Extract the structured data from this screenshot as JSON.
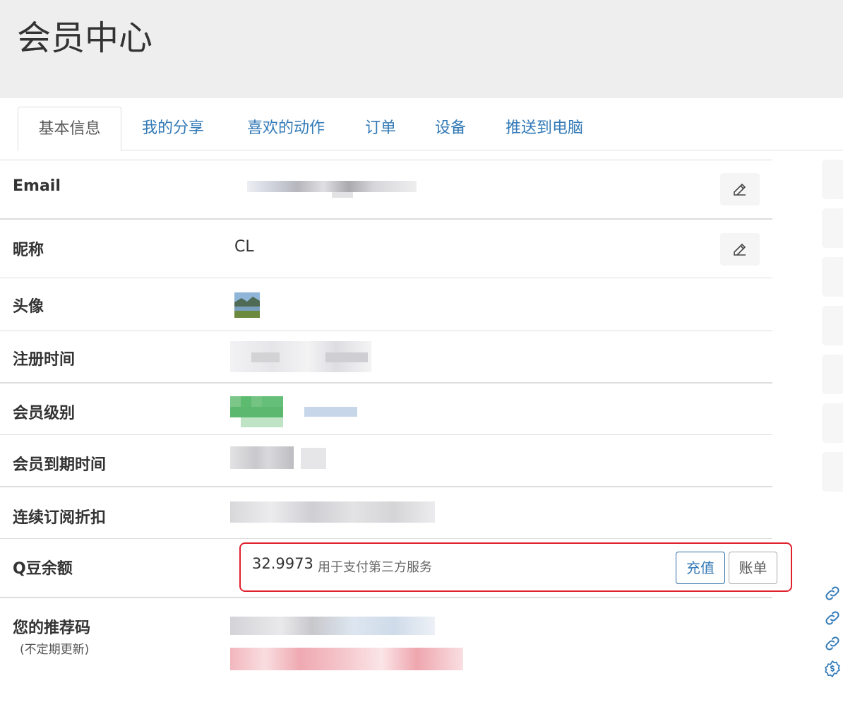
{
  "page": {
    "title": "会员中心"
  },
  "tabs": [
    {
      "label": "基本信息",
      "active": true
    },
    {
      "label": "我的分享",
      "active": false
    },
    {
      "label": "喜欢的动作",
      "active": false
    },
    {
      "label": "订单",
      "active": false
    },
    {
      "label": "设备",
      "active": false
    },
    {
      "label": "推送到电脑",
      "active": false
    }
  ],
  "rows": {
    "email": {
      "label": "Email",
      "value": ""
    },
    "nickname": {
      "label": "昵称",
      "value": "CL"
    },
    "avatar": {
      "label": "头像"
    },
    "register_time": {
      "label": "注册时间",
      "value": ""
    },
    "member_level": {
      "label": "会员级别",
      "value": ""
    },
    "member_expire": {
      "label": "会员到期时间",
      "value": ""
    },
    "subscription_discount": {
      "label": "连续订阅折扣",
      "value": ""
    },
    "q_balance": {
      "label": "Q豆余额",
      "value": "32.9973",
      "note": "用于支付第三方服务",
      "recharge_label": "充值",
      "bill_label": "账单"
    },
    "referral": {
      "label": "您的推荐码",
      "sublabel": "(不定期更新)",
      "value": ""
    }
  },
  "icons": {
    "edit": "edit-icon",
    "link": "link-icon",
    "money": "dollar-badge-icon"
  },
  "colors": {
    "link_blue": "#337ab7",
    "highlight_red": "#e0202c",
    "header_bg": "#eeeeee"
  }
}
